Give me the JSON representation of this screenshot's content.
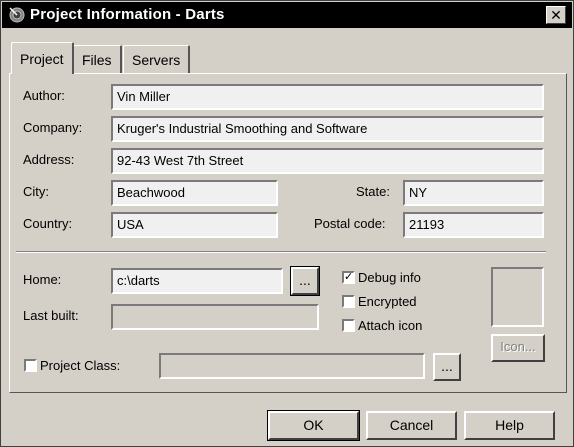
{
  "window": {
    "title": "Project Information - Darts",
    "close_glyph": "✕"
  },
  "tabs": [
    {
      "label": "Project"
    },
    {
      "label": "Files"
    },
    {
      "label": "Servers"
    }
  ],
  "form": {
    "author": {
      "label": "Author:",
      "value": "Vin Miller"
    },
    "company": {
      "label": "Company:",
      "value": "Kruger's Industrial Smoothing and Software"
    },
    "address": {
      "label": "Address:",
      "value": "92-43 West 7th Street"
    },
    "city": {
      "label": "City:",
      "value": "Beachwood"
    },
    "state": {
      "label": "State:",
      "value": "NY"
    },
    "country": {
      "label": "Country:",
      "value": "USA"
    },
    "postal": {
      "label": "Postal code:",
      "value": "21193"
    },
    "home": {
      "label": "Home:",
      "value": "c:\\darts",
      "browse": "..."
    },
    "last_built": {
      "label": "Last built:",
      "value": ""
    },
    "project_class": {
      "label": "Project Class:",
      "value": "",
      "browse": "..."
    }
  },
  "options": {
    "debug_info": {
      "label": "Debug info",
      "checked": true
    },
    "encrypted": {
      "label": "Encrypted",
      "checked": false
    },
    "attach_icon": {
      "label": "Attach icon",
      "checked": false
    },
    "check_glyph": "✓"
  },
  "icon_button": {
    "label": "Icon..."
  },
  "buttons": {
    "ok": "OK",
    "cancel": "Cancel",
    "help": "Help"
  }
}
